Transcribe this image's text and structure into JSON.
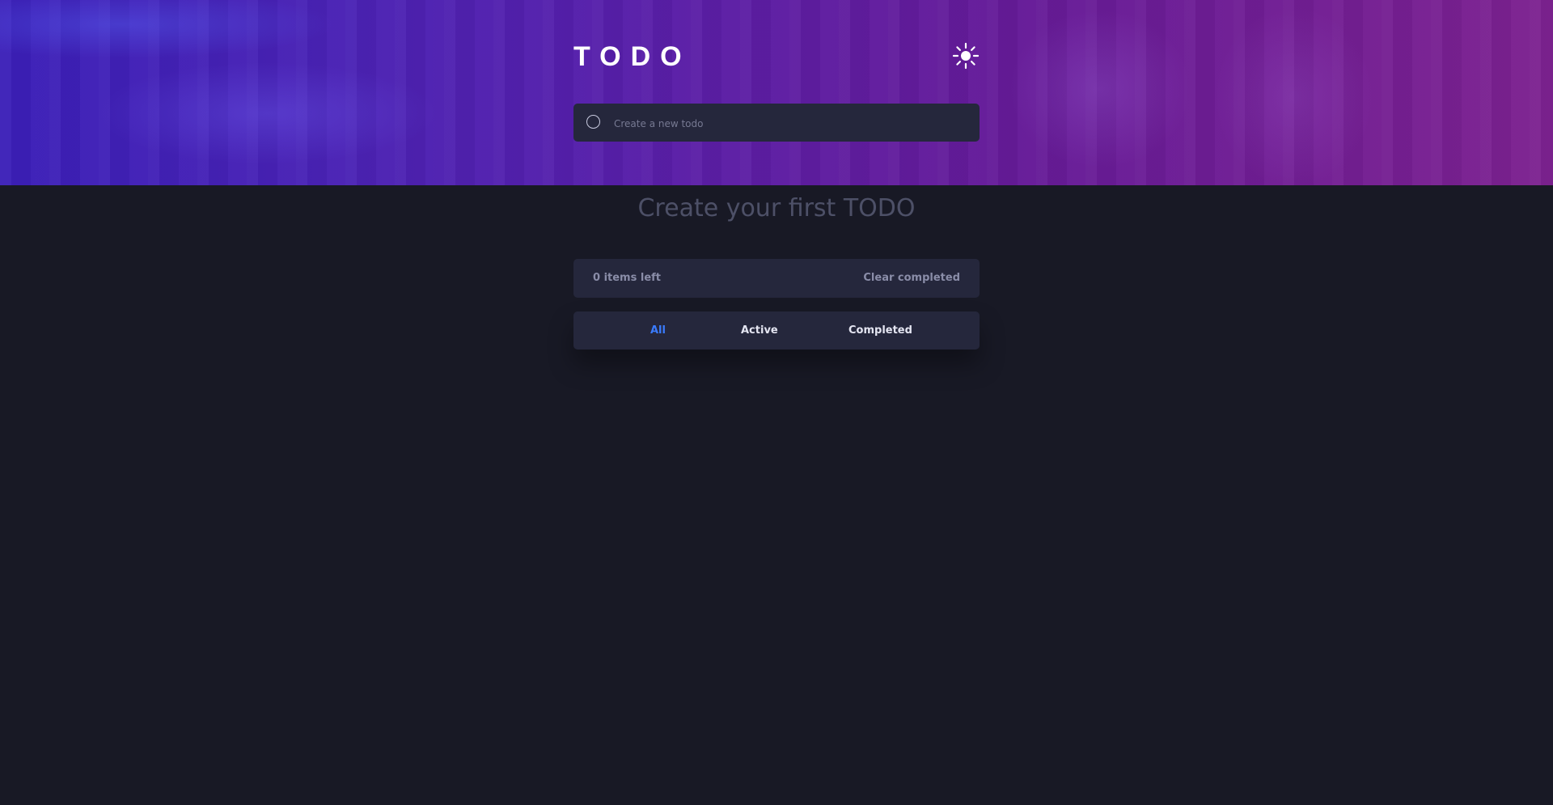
{
  "header": {
    "title": "TODO",
    "theme_icon": "sun-icon"
  },
  "new_todo": {
    "placeholder": "Create a new todo",
    "value": ""
  },
  "empty_state": {
    "message": "Create your first TODO"
  },
  "footer": {
    "items_left": "0 items left",
    "clear_label": "Clear completed"
  },
  "filters": {
    "all": "All",
    "active": "Active",
    "completed": "Completed",
    "selected": "All"
  },
  "colors": {
    "background": "#181925",
    "card": "#25273c",
    "accent": "#3a7bfd",
    "gradient_start": "#3b1fb8",
    "gradient_end": "#7d2290"
  }
}
